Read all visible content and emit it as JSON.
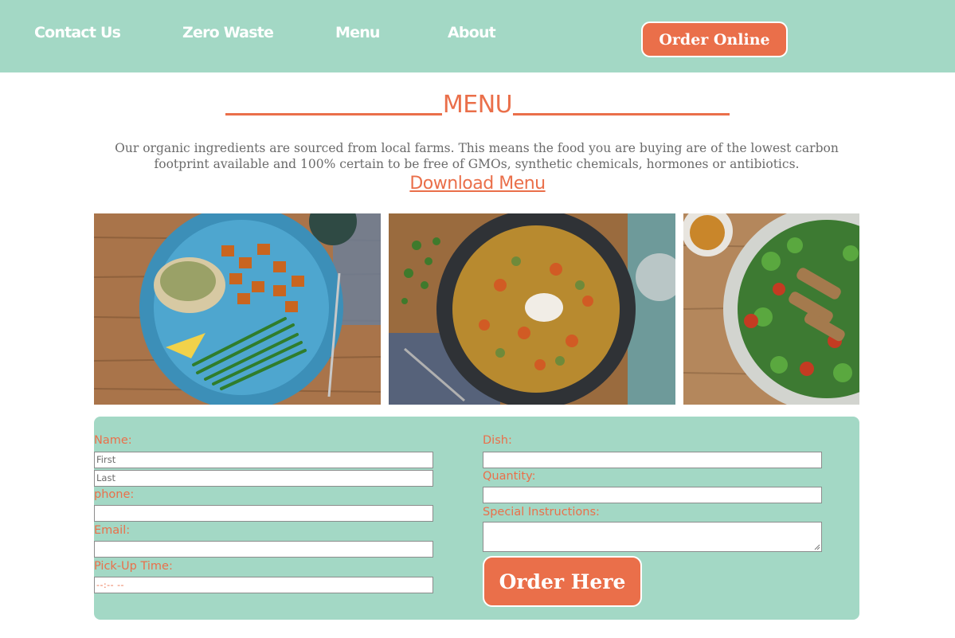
{
  "nav": {
    "links": [
      "Contact Us",
      "Zero Waste",
      "Menu",
      "About"
    ],
    "order_online": "Order Online"
  },
  "header": {
    "title": "MENU",
    "intro": "Our organic ingredients are sourced from local farms. This means the food you are buying are of the lowest carbon footprint available and 100% certain to be free of GMOs, synthetic chemicals, hormones or antibiotics.",
    "download_link": "Download Menu"
  },
  "gallery": {
    "images": [
      "chicken-sweet-potato-green-beans-dish",
      "spiced-rice-pilaf-dish",
      "chicken-salad-dish"
    ]
  },
  "form": {
    "name_label": "Name:",
    "first_placeholder": "First",
    "last_placeholder": "Last",
    "phone_label": "phone:",
    "email_label": "Email:",
    "pickup_label": "Pick-Up Time:",
    "pickup_placeholder": "--:-- --",
    "dish_label": "Dish:",
    "quantity_label": "Quantity:",
    "special_label": "Special Instructions:",
    "submit_label": "Order Here"
  },
  "colors": {
    "mint": "#a3d8c5",
    "accent": "#ea6f4a",
    "text_gray": "#6b6b6b",
    "white": "#ffffff"
  }
}
